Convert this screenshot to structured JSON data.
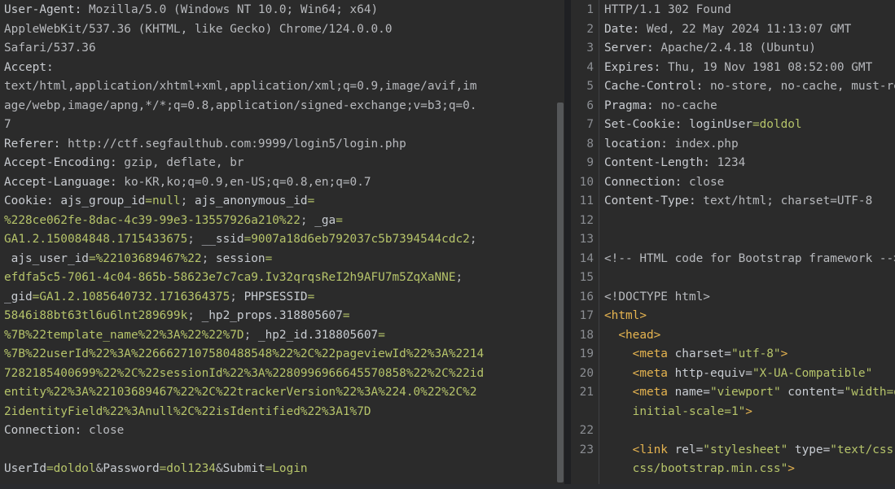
{
  "request": {
    "lines": [
      [
        {
          "t": "User-Agent: ",
          "c": "hk"
        },
        {
          "t": "Mozilla/5.0 (Windows NT 10.0; Win64; x64)",
          "c": "hv"
        }
      ],
      [
        {
          "t": "AppleWebKit/537.36 (KHTML, like Gecko) Chrome/124.0.0.0",
          "c": "hv"
        }
      ],
      [
        {
          "t": "Safari/537.36",
          "c": "hv"
        }
      ],
      [
        {
          "t": "Accept:",
          "c": "hk"
        }
      ],
      [
        {
          "t": "text/html,application/xhtml+xml,application/xml;q=0.9,image/avif,im",
          "c": "hv"
        }
      ],
      [
        {
          "t": "age/webp,image/apng,*/*;q=0.8,application/signed-exchange;v=b3;q=0.",
          "c": "hv"
        }
      ],
      [
        {
          "t": "7",
          "c": "hv"
        }
      ],
      [
        {
          "t": "Referer: ",
          "c": "hk"
        },
        {
          "t": "http://ctf.segfaulthub.com:9999/login5/login.php",
          "c": "hv"
        }
      ],
      [
        {
          "t": "Accept-Encoding: ",
          "c": "hk"
        },
        {
          "t": "gzip, deflate, br",
          "c": "hv"
        }
      ],
      [
        {
          "t": "Accept-Language: ",
          "c": "hk"
        },
        {
          "t": "ko-KR,ko;q=0.9,en-US;q=0.8,en;q=0.7",
          "c": "hv"
        }
      ],
      [
        {
          "t": "Cookie: ",
          "c": "hk"
        },
        {
          "t": "ajs_group_id",
          "c": "ck"
        },
        {
          "t": "=null",
          "c": "cv"
        },
        {
          "t": "; ",
          "c": "hv"
        },
        {
          "t": "ajs_anonymous_id",
          "c": "ck"
        },
        {
          "t": "=",
          "c": "cv"
        }
      ],
      [
        {
          "t": "%228ce062fe-8dac-4c39-99e3-13557926a210%22",
          "c": "cv"
        },
        {
          "t": "; ",
          "c": "hv"
        },
        {
          "t": "_ga",
          "c": "ck"
        },
        {
          "t": "=",
          "c": "cv"
        }
      ],
      [
        {
          "t": "GA1.2.150084848.1715433675",
          "c": "cv"
        },
        {
          "t": "; ",
          "c": "hv"
        },
        {
          "t": "__ssid",
          "c": "ck"
        },
        {
          "t": "=9007a18d6eb792037c5b7394544cdc2",
          "c": "cv"
        },
        {
          "t": ";",
          "c": "hv"
        }
      ],
      [
        {
          "t": " ajs_user_id",
          "c": "ck"
        },
        {
          "t": "=%22103689467%22",
          "c": "cv"
        },
        {
          "t": "; ",
          "c": "hv"
        },
        {
          "t": "session",
          "c": "ck"
        },
        {
          "t": "=",
          "c": "cv"
        }
      ],
      [
        {
          "t": "efdfa5c5-7061-4c04-865b-58623e7c7ca9.Iv32qrqsReI2h9AFU7m5ZqXaNNE",
          "c": "cv"
        },
        {
          "t": ";",
          "c": "hv"
        }
      ],
      [
        {
          "t": "_gid",
          "c": "ck"
        },
        {
          "t": "=GA1.2.1085640732.1716364375",
          "c": "cv"
        },
        {
          "t": "; ",
          "c": "hv"
        },
        {
          "t": "PHPSESSID",
          "c": "ck"
        },
        {
          "t": "=",
          "c": "cv"
        }
      ],
      [
        {
          "t": "5846i88bt63tl6u6lnt289699k",
          "c": "cv"
        },
        {
          "t": "; ",
          "c": "hv"
        },
        {
          "t": "_hp2_props.318805607",
          "c": "ck"
        },
        {
          "t": "=",
          "c": "cv"
        }
      ],
      [
        {
          "t": "%7B%22template_name%22%3A%22%22%7D",
          "c": "cv"
        },
        {
          "t": "; ",
          "c": "hv"
        },
        {
          "t": "_hp2_id.318805607",
          "c": "ck"
        },
        {
          "t": "=",
          "c": "cv"
        }
      ],
      [
        {
          "t": "%7B%22userId%22%3A%2266627107580488548%22%2C%22pageviewId%22%3A%2214",
          "c": "cv"
        }
      ],
      [
        {
          "t": "7282185400699%22%2C%22sessionId%22%3A%2280996966645570858%22%2C%22id",
          "c": "cv"
        }
      ],
      [
        {
          "t": "entity%22%3A%22103689467%22%2C%22trackerVersion%22%3A%224.0%22%2C%2",
          "c": "cv"
        }
      ],
      [
        {
          "t": "2identityField%22%3Anull%2C%22isIdentified%22%3A1%7D",
          "c": "cv"
        }
      ],
      [
        {
          "t": "Connection: ",
          "c": "hk"
        },
        {
          "t": "close",
          "c": "hv"
        }
      ],
      [
        {
          "t": "",
          "c": "hv"
        }
      ],
      [
        {
          "t": "UserId",
          "c": "ck"
        },
        {
          "t": "=doldol",
          "c": "cv"
        },
        {
          "t": "&",
          "c": "hv"
        },
        {
          "t": "Password",
          "c": "ck"
        },
        {
          "t": "=dol1234",
          "c": "cv"
        },
        {
          "t": "&",
          "c": "hv"
        },
        {
          "t": "Submit",
          "c": "ck"
        },
        {
          "t": "=Login",
          "c": "cv"
        }
      ]
    ]
  },
  "response": {
    "lines": [
      {
        "n": "1",
        "row": 0,
        "segs": [
          {
            "t": "HTTP/1.1 302 Found",
            "c": "hv"
          }
        ]
      },
      {
        "n": "2",
        "row": 1,
        "segs": [
          {
            "t": "Date: ",
            "c": "hk"
          },
          {
            "t": "Wed, 22 May 2024 11:13:07 GMT",
            "c": "hv"
          }
        ]
      },
      {
        "n": "3",
        "row": 2,
        "segs": [
          {
            "t": "Server: ",
            "c": "hk"
          },
          {
            "t": "Apache/2.4.18 (Ubuntu)",
            "c": "hv"
          }
        ]
      },
      {
        "n": "4",
        "row": 3,
        "segs": [
          {
            "t": "Expires: ",
            "c": "hk"
          },
          {
            "t": "Thu, 19 Nov 1981 08:52:00 GMT",
            "c": "hv"
          }
        ]
      },
      {
        "n": "5",
        "row": 4,
        "segs": [
          {
            "t": "Cache-Control: ",
            "c": "hk"
          },
          {
            "t": "no-store, no-cache, must-revalidate",
            "c": "hv"
          }
        ]
      },
      {
        "n": "6",
        "row": 5,
        "segs": [
          {
            "t": "Pragma: ",
            "c": "hk"
          },
          {
            "t": "no-cache",
            "c": "hv"
          }
        ]
      },
      {
        "n": "7",
        "row": 6,
        "segs": [
          {
            "t": "Set-Cookie: ",
            "c": "hk"
          },
          {
            "t": "loginUser",
            "c": "ck"
          },
          {
            "t": "=doldol",
            "c": "hl"
          }
        ]
      },
      {
        "n": "8",
        "row": 7,
        "segs": [
          {
            "t": "location: ",
            "c": "hk"
          },
          {
            "t": "index.php",
            "c": "hv"
          }
        ]
      },
      {
        "n": "9",
        "row": 8,
        "segs": [
          {
            "t": "Content-Length: ",
            "c": "hk"
          },
          {
            "t": "1234",
            "c": "hv"
          }
        ]
      },
      {
        "n": "10",
        "row": 9,
        "segs": [
          {
            "t": "Connection: ",
            "c": "hk"
          },
          {
            "t": "close",
            "c": "hv"
          }
        ]
      },
      {
        "n": "11",
        "row": 10,
        "segs": [
          {
            "t": "Content-Type: ",
            "c": "hk"
          },
          {
            "t": "text/html; charset=UTF-8",
            "c": "hv"
          }
        ]
      },
      {
        "n": "12",
        "row": 11,
        "segs": [
          {
            "t": "",
            "c": "hv"
          }
        ]
      },
      {
        "n": "13",
        "row": 12,
        "segs": [
          {
            "t": "",
            "c": "hv"
          }
        ]
      },
      {
        "n": "14",
        "row": 13,
        "segs": [
          {
            "t": "<!-- HTML code for Bootstrap framework -->",
            "c": "cm"
          }
        ]
      },
      {
        "n": "15",
        "row": 14,
        "segs": [
          {
            "t": "",
            "c": "hv"
          }
        ]
      },
      {
        "n": "16",
        "row": 15,
        "segs": [
          {
            "t": "<!DOCTYPE html>",
            "c": "cm"
          }
        ]
      },
      {
        "n": "17",
        "row": 16,
        "segs": [
          {
            "t": "<html>",
            "c": "tag"
          }
        ]
      },
      {
        "n": "18",
        "row": 17,
        "segs": [
          {
            "t": "  ",
            "c": "hv"
          },
          {
            "t": "<head>",
            "c": "tag"
          }
        ]
      },
      {
        "n": "19",
        "row": 18,
        "segs": [
          {
            "t": "    ",
            "c": "hv"
          },
          {
            "t": "<meta ",
            "c": "tag"
          },
          {
            "t": "charset=",
            "c": "attr"
          },
          {
            "t": "\"utf-8\"",
            "c": "val"
          },
          {
            "t": ">",
            "c": "tag"
          }
        ]
      },
      {
        "n": "20",
        "row": 19,
        "segs": [
          {
            "t": "    ",
            "c": "hv"
          },
          {
            "t": "<meta ",
            "c": "tag"
          },
          {
            "t": "http-equiv=",
            "c": "attr"
          },
          {
            "t": "\"X-UA-Compatible\"",
            "c": "val"
          }
        ]
      },
      {
        "n": "21",
        "row": 20,
        "segs": [
          {
            "t": "    ",
            "c": "hv"
          },
          {
            "t": "<meta ",
            "c": "tag"
          },
          {
            "t": "name=",
            "c": "attr"
          },
          {
            "t": "\"viewport\"",
            "c": "val"
          },
          {
            "t": " content=",
            "c": "attr"
          },
          {
            "t": "\"width=device-width,",
            "c": "val"
          }
        ]
      },
      {
        "n": "",
        "row": 21,
        "segs": [
          {
            "t": "    ",
            "c": "hv"
          },
          {
            "t": "initial-scale=1\"",
            "c": "val"
          },
          {
            "t": ">",
            "c": "tag"
          }
        ]
      },
      {
        "n": "22",
        "row": 22,
        "segs": [
          {
            "t": "",
            "c": "hv"
          }
        ]
      },
      {
        "n": "23",
        "row": 23,
        "segs": [
          {
            "t": "    ",
            "c": "hv"
          },
          {
            "t": "<link ",
            "c": "tag"
          },
          {
            "t": "rel=",
            "c": "attr"
          },
          {
            "t": "\"stylesheet\"",
            "c": "val"
          },
          {
            "t": " type=",
            "c": "attr"
          },
          {
            "t": "\"text/css\"",
            "c": "val"
          }
        ]
      },
      {
        "n": "",
        "row": 24,
        "segs": [
          {
            "t": "    ",
            "c": "hv"
          },
          {
            "t": "css/bootstrap.min.css\"",
            "c": "val"
          },
          {
            "t": ">",
            "c": "tag"
          }
        ]
      }
    ]
  }
}
